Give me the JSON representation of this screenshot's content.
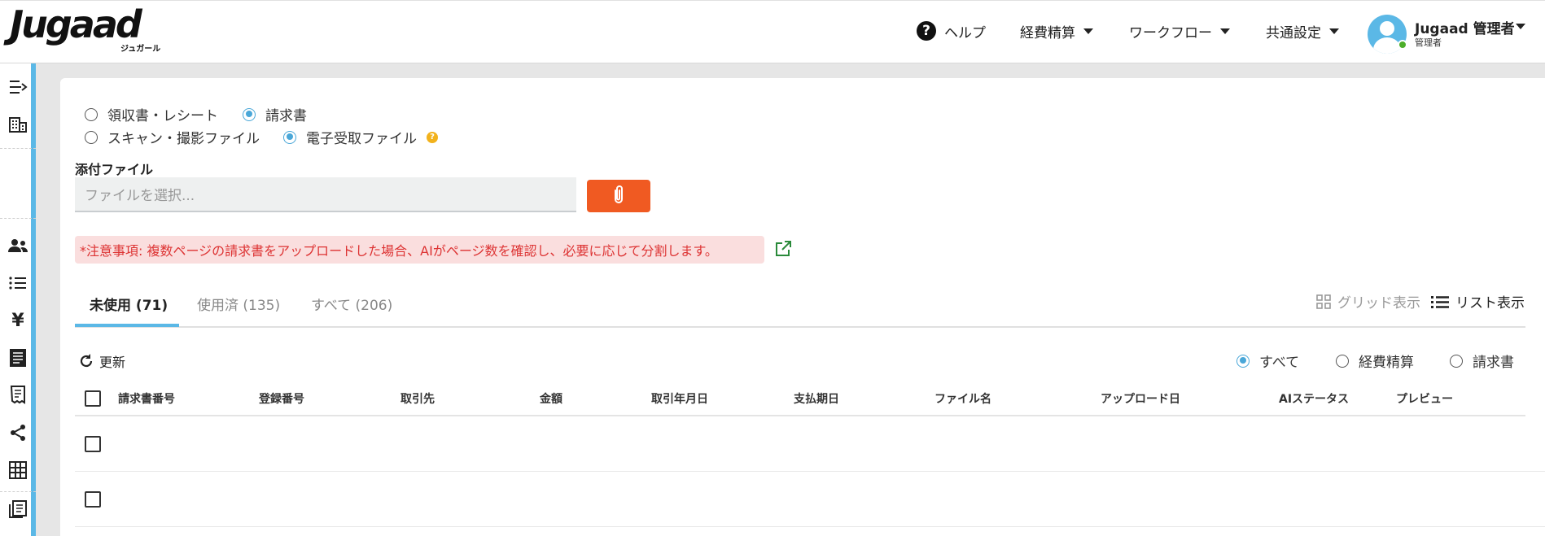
{
  "brand": {
    "logo": "Jugaad",
    "logo_sub": "ジュガール"
  },
  "nav": {
    "help": "ヘルプ",
    "expense": "経費精算",
    "workflow": "ワークフロー",
    "common_settings": "共通設定"
  },
  "user": {
    "name": "Jugaad 管理者",
    "role": "管理者",
    "status_color": "#4cae2a"
  },
  "sidebar": {
    "icons": [
      "expand-menu-icon",
      "building-icon",
      "users-icon",
      "list-icon",
      "yen-icon",
      "receipt-icon",
      "invoice-icon",
      "share-icon",
      "grid-icon",
      "journal-icon"
    ],
    "yen_symbol": "¥"
  },
  "doc_type": {
    "receipt": "領収書・レシート",
    "invoice": "請求書",
    "selected": "請求書"
  },
  "file_type": {
    "scan": "スキャン・撮影ファイル",
    "electronic": "電子受取ファイル",
    "selected": "電子受取ファイル"
  },
  "attach": {
    "label": "添付ファイル",
    "placeholder": "ファイルを選択..."
  },
  "notice": "*注意事項:  複数ページの請求書をアップロードした場合、AIがページ数を確認し、必要に応じて分割します。",
  "tabs": [
    {
      "label": "未使用 (71)",
      "active": true
    },
    {
      "label": "使用済 (135)",
      "active": false
    },
    {
      "label": "すべて (206)",
      "active": false
    }
  ],
  "view": {
    "grid": "グリッド表示",
    "list": "リスト表示",
    "active": "list"
  },
  "refresh_label": "更新",
  "filter": {
    "all": "すべて",
    "expense": "経費精算",
    "invoice": "請求書",
    "selected": "すべて"
  },
  "table": {
    "columns": [
      "請求書番号",
      "登録番号",
      "取引先",
      "金額",
      "取引年月日",
      "支払期日",
      "ファイル名",
      "アップロード日",
      "AIステータス",
      "プレビュー"
    ],
    "rows": 2
  },
  "colors": {
    "accent": "#5bb8e6",
    "attach_button": "#f05a22",
    "notice_bg": "#fadede",
    "notice_text": "#dd3333"
  }
}
